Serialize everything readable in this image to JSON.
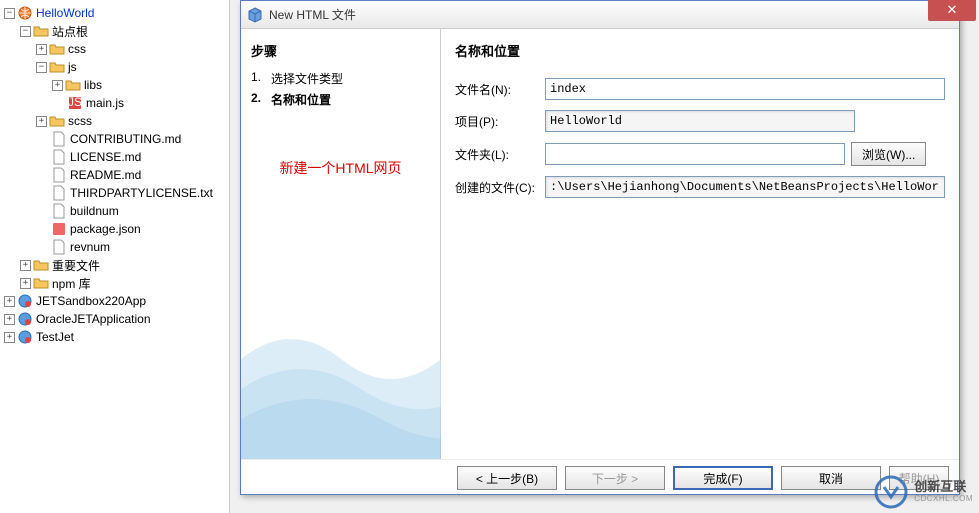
{
  "tree": {
    "root": "HelloWorld",
    "sitesRoot": "站点根",
    "css": "css",
    "js": "js",
    "libs": "libs",
    "mainjs": "main.js",
    "scss": "scss",
    "contrib": "CONTRIBUTING.md",
    "license": "LICENSE.md",
    "readme": "README.md",
    "third": "THIRDPARTYLICENSE.txt",
    "buildnum": "buildnum",
    "pkgjson": "package.json",
    "revnum": "revnum",
    "important": "重要文件",
    "npm": "npm 库",
    "jetsandbox": "JETSandbox220App",
    "oraclejet": "OracleJETApplication",
    "testjet": "TestJet"
  },
  "dialog": {
    "title": "New HTML 文件",
    "stepsHeading": "步骤",
    "step1": "选择文件类型",
    "step2": "名称和位置",
    "annotation": "新建一个HTML网页",
    "formHeading": "名称和位置",
    "labels": {
      "filename": "文件名(N):",
      "project": "项目(P):",
      "folder": "文件夹(L):",
      "created": "创建的文件(C):",
      "browse": "浏览(W)..."
    },
    "values": {
      "filename": "index",
      "project": "HelloWorld",
      "folder": "",
      "created": ":\\Users\\Hejianhong\\Documents\\NetBeansProjects\\HelloWorld\\index.html"
    },
    "buttons": {
      "back": "< 上一步(B)",
      "next": "下一步 >",
      "finish": "完成(F)",
      "cancel": "取消",
      "help": "帮助(H)"
    }
  },
  "watermark": {
    "line1": "创新互联",
    "line2": "CDCXHL.COM"
  }
}
